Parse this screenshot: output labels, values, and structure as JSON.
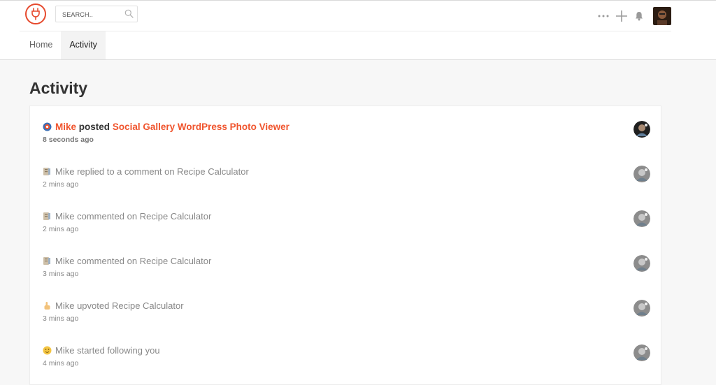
{
  "header": {
    "search_placeholder": "SEARCH..",
    "more_icon": "ellipsis-icon",
    "add_icon": "plus-icon",
    "notifications_icon": "bell-icon",
    "brand_color": "#e64a2e"
  },
  "nav": {
    "tabs": [
      {
        "label": "Home",
        "active": false
      },
      {
        "label": "Activity",
        "active": true
      }
    ]
  },
  "page": {
    "title": "Activity"
  },
  "activity": [
    {
      "icon": "product-icon",
      "actor": "Mike",
      "verb": "posted",
      "object": "Social Gallery WordPress Photo Viewer",
      "time": "8 seconds ago"
    },
    {
      "icon": "comment-icon",
      "actor": "Mike",
      "verb": "replied to a comment on",
      "object": "Recipe Calculator",
      "time": "2 mins ago"
    },
    {
      "icon": "comment-icon",
      "actor": "Mike",
      "verb": "commented on",
      "object": "Recipe Calculator",
      "time": "2 mins ago"
    },
    {
      "icon": "comment-icon",
      "actor": "Mike",
      "verb": "commented on",
      "object": "Recipe Calculator",
      "time": "3 mins ago"
    },
    {
      "icon": "upvote-icon",
      "actor": "Mike",
      "verb": "upvoted",
      "object": "Recipe Calculator",
      "time": "3 mins ago"
    },
    {
      "icon": "follow-icon",
      "actor": "Mike",
      "verb": "started following",
      "object": "you",
      "time": "4 mins ago"
    }
  ]
}
